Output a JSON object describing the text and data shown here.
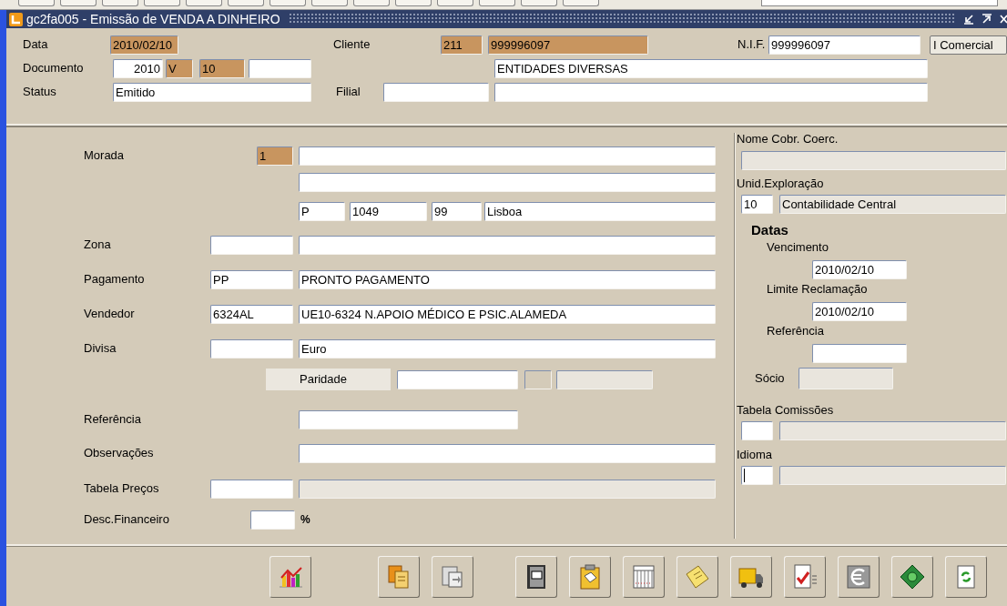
{
  "window": {
    "title": "gc2fa005 - Emissão de VENDA A DINHEIRO"
  },
  "header": {
    "data": {
      "label": "Data",
      "field": {
        "kind": "key",
        "value": "2010/02/10"
      }
    },
    "cliente": {
      "label": "Cliente",
      "code": {
        "kind": "key",
        "value": "211"
      },
      "name": {
        "kind": "key",
        "value": "999996097"
      }
    },
    "nif": {
      "label": "N.I.F.",
      "field": {
        "kind": "input",
        "value": "999996097"
      }
    },
    "comercial_button": "I Comercial",
    "documento": {
      "label": "Documento",
      "year": {
        "kind": "input",
        "value": "2010"
      },
      "series": {
        "kind": "key",
        "value": "V"
      },
      "number": {
        "kind": "key",
        "value": "10"
      },
      "extra": {
        "kind": "input"
      }
    },
    "cliente_nome": {
      "kind": "input",
      "value": "ENTIDADES DIVERSAS"
    },
    "status": {
      "label": "Status",
      "field": {
        "kind": "input",
        "value": "Emitido"
      }
    },
    "filial": {
      "label": "Filial",
      "code": {
        "kind": "input"
      },
      "name": {
        "kind": "input"
      }
    }
  },
  "main": {
    "morada": {
      "label": "Morada",
      "code": {
        "kind": "key",
        "value": "1"
      },
      "line_1": {
        "kind": "input"
      },
      "line_2": {
        "kind": "input"
      },
      "country": {
        "kind": "input",
        "value": "P"
      },
      "postal_code": {
        "kind": "input",
        "value": "1049"
      },
      "postal_ext": {
        "kind": "input",
        "value": "99"
      },
      "city": {
        "kind": "input",
        "value": "Lisboa"
      }
    },
    "rows": [
      {
        "label": "Zona",
        "code": {
          "kind": "input"
        },
        "name": {
          "kind": "input"
        }
      },
      {
        "label": "Pagamento",
        "code": {
          "kind": "input",
          "value": "PP"
        },
        "name": {
          "kind": "input",
          "value": "PRONTO PAGAMENTO"
        }
      },
      {
        "label": "Vendedor",
        "code": {
          "kind": "input",
          "value": "6324AL"
        },
        "name": {
          "kind": "input",
          "value": "UE10-6324 N.APOIO MÉDICO E PSIC.ALAMEDA"
        }
      },
      {
        "label": "Divisa",
        "code": {
          "kind": "input"
        },
        "name": {
          "kind": "input",
          "value": "Euro"
        }
      }
    ],
    "paridade": {
      "label": "Paridade",
      "value": {
        "kind": "input"
      },
      "flag": {
        "kind": "readonly"
      },
      "desc": {
        "kind": "readonly"
      }
    },
    "referencia": {
      "label": "Referência",
      "field": {
        "kind": "input"
      }
    },
    "observacoes": {
      "label": "Observações",
      "field": {
        "kind": "input"
      }
    },
    "tabela_precos": {
      "label": "Tabela Preços",
      "code": {
        "kind": "input"
      },
      "name": {
        "kind": "readonly"
      }
    },
    "desc_financeiro": {
      "label": "Desc.Financeiro",
      "field": {
        "kind": "input"
      },
      "unit": "%"
    }
  },
  "side": {
    "nome_cobr": {
      "label": "Nome Cobr. Coerc.",
      "field": {
        "kind": "readonly"
      }
    },
    "unid": {
      "label": "Unid.Exploração",
      "code": {
        "kind": "input",
        "value": "10"
      },
      "name": {
        "kind": "readonly",
        "value": "Contabilidade Central"
      }
    },
    "datas_title": "Datas",
    "datas": [
      {
        "label": "Vencimento",
        "field": {
          "kind": "input",
          "value": "2010/02/10"
        }
      },
      {
        "label": "Limite Reclamação",
        "field": {
          "kind": "input",
          "value": "2010/02/10"
        }
      },
      {
        "label": "Referência",
        "field": {
          "kind": "input"
        }
      }
    ],
    "socio": {
      "label": "Sócio",
      "field": {
        "kind": "readonly"
      }
    },
    "tabela_comissoes": {
      "label": "Tabela Comissões",
      "code": {
        "kind": "input"
      },
      "name": {
        "kind": "readonly"
      }
    },
    "idioma": {
      "label": "Idioma",
      "code": {
        "kind": "input",
        "focused": true
      },
      "name": {
        "kind": "readonly"
      }
    }
  },
  "toolbar": [
    [
      {
        "kind": "chart"
      }
    ],
    [
      {
        "kind": "copy"
      },
      {
        "kind": "paste"
      }
    ],
    [
      {
        "kind": "notebook"
      },
      {
        "kind": "clipboard"
      },
      {
        "kind": "grid"
      },
      {
        "kind": "note"
      },
      {
        "kind": "truck"
      },
      {
        "kind": "checklist"
      },
      {
        "kind": "euro"
      },
      {
        "kind": "money"
      },
      {
        "kind": "refresh"
      }
    ]
  ]
}
